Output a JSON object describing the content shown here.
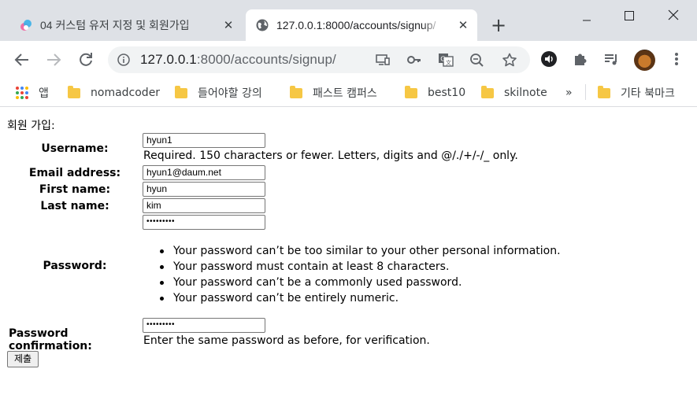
{
  "browser": {
    "tabs": [
      {
        "title": "04 커스텀 유저 지정 및 회원가입",
        "active": false
      },
      {
        "title": "127.0.0.1:8000/accounts/signup/",
        "active": true
      }
    ],
    "new_tab_icon": "plus-icon",
    "window_controls": [
      "minimize-icon",
      "maximize-icon",
      "close-icon"
    ],
    "toolbar": {
      "back_icon": "back-arrow-icon",
      "forward_icon": "forward-arrow-icon",
      "reload_icon": "reload-icon",
      "url_host": "127.0.0.1",
      "url_rest": ":8000/accounts/signup/",
      "omnibox_icons": [
        "cast-icon",
        "key-icon",
        "translate-icon",
        "zoom-out-icon",
        "star-icon"
      ],
      "extension_icons": [
        "audio-extension-icon",
        "puzzle-icon",
        "media-playlist-icon"
      ],
      "menu_icon": "kebab-menu-icon"
    },
    "bookmarks": {
      "apps_label": "앱",
      "items": [
        "nomadcoder",
        "들어야할 강의",
        "패스트 캠퍼스",
        "best10",
        "skilnote"
      ],
      "overflow": "»",
      "other": "기타 북마크"
    }
  },
  "form": {
    "title": "회원 가입:",
    "username": {
      "label": "Username:",
      "value": "hyun1",
      "help": "Required. 150 characters or fewer. Letters, digits and @/./+/-/_ only."
    },
    "email": {
      "label": "Email address:",
      "value": "hyun1@daum.net"
    },
    "first_name": {
      "label": "First name:",
      "value": "hyun"
    },
    "last_name": {
      "label": "Last name:",
      "value": "kim"
    },
    "password": {
      "label": "Password:",
      "value": "•••••••••",
      "help_items": [
        "Your password can’t be too similar to your other personal information.",
        "Your password must contain at least 8 characters.",
        "Your password can’t be a commonly used password.",
        "Your password can’t be entirely numeric."
      ]
    },
    "password_confirmation": {
      "label": "Password confirmation:",
      "value": "•••••••••",
      "help": "Enter the same password as before, for verification."
    },
    "submit_label": "제출"
  },
  "colors": {
    "tab_strip": "#dee1e6",
    "omnibox": "#f1f3f4",
    "bookmark_folder": "#f6c744",
    "icon_gray": "#5f6368"
  }
}
